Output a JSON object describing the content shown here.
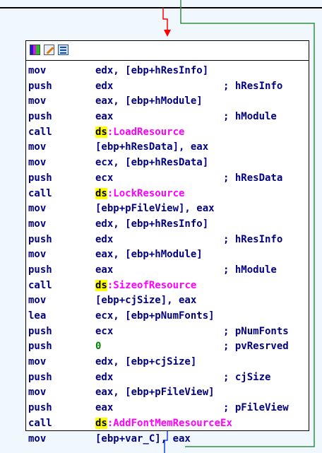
{
  "graph": {
    "edge_colors": {
      "taken": "#ff0000",
      "fallthrough": "#2f8f3f",
      "normal": "#1a40e0"
    }
  },
  "node": {
    "toolbar_icons": [
      "palette-icon",
      "edit-icon",
      "graph-icon"
    ],
    "lines": [
      {
        "mnemonic": "mov",
        "operands": "edx, [ebp+hResInfo]",
        "comment": ""
      },
      {
        "mnemonic": "push",
        "operands": "edx",
        "comment": "; hResInfo"
      },
      {
        "mnemonic": "mov",
        "operands": "eax, [ebp+hModule]",
        "comment": ""
      },
      {
        "mnemonic": "push",
        "operands": "eax",
        "comment": "; hModule"
      },
      {
        "mnemonic": "call",
        "operands_prefix": "ds",
        "operands_fn": "LoadResource",
        "comment": ""
      },
      {
        "mnemonic": "mov",
        "operands": "[ebp+hResData], eax",
        "comment": ""
      },
      {
        "mnemonic": "mov",
        "operands": "ecx, [ebp+hResData]",
        "comment": ""
      },
      {
        "mnemonic": "push",
        "operands": "ecx",
        "comment": "; hResData"
      },
      {
        "mnemonic": "call",
        "operands_prefix": "ds",
        "operands_fn": "LockResource",
        "comment": ""
      },
      {
        "mnemonic": "mov",
        "operands": "[ebp+pFileView], eax",
        "comment": ""
      },
      {
        "mnemonic": "mov",
        "operands": "edx, [ebp+hResInfo]",
        "comment": ""
      },
      {
        "mnemonic": "push",
        "operands": "edx",
        "comment": "; hResInfo"
      },
      {
        "mnemonic": "mov",
        "operands": "eax, [ebp+hModule]",
        "comment": ""
      },
      {
        "mnemonic": "push",
        "operands": "eax",
        "comment": "; hModule"
      },
      {
        "mnemonic": "call",
        "operands_prefix": "ds",
        "operands_fn": "SizeofResource",
        "comment": ""
      },
      {
        "mnemonic": "mov",
        "operands": "[ebp+cjSize], eax",
        "comment": ""
      },
      {
        "mnemonic": "lea",
        "operands": "ecx, [ebp+pNumFonts]",
        "comment": ""
      },
      {
        "mnemonic": "push",
        "operands": "ecx",
        "comment": "; pNumFonts"
      },
      {
        "mnemonic": "push",
        "operands_num": "0",
        "comment": "; pvResrved"
      },
      {
        "mnemonic": "mov",
        "operands": "edx, [ebp+cjSize]",
        "comment": ""
      },
      {
        "mnemonic": "push",
        "operands": "edx",
        "comment": "; cjSize"
      },
      {
        "mnemonic": "mov",
        "operands": "eax, [ebp+pFileView]",
        "comment": ""
      },
      {
        "mnemonic": "push",
        "operands": "eax",
        "comment": "; pFileView"
      },
      {
        "mnemonic": "call",
        "operands_prefix": "ds",
        "operands_fn": "AddFontMemResourceEx",
        "comment": ""
      },
      {
        "mnemonic": "mov",
        "operands": "[ebp+var_C], eax",
        "comment": ""
      }
    ]
  }
}
